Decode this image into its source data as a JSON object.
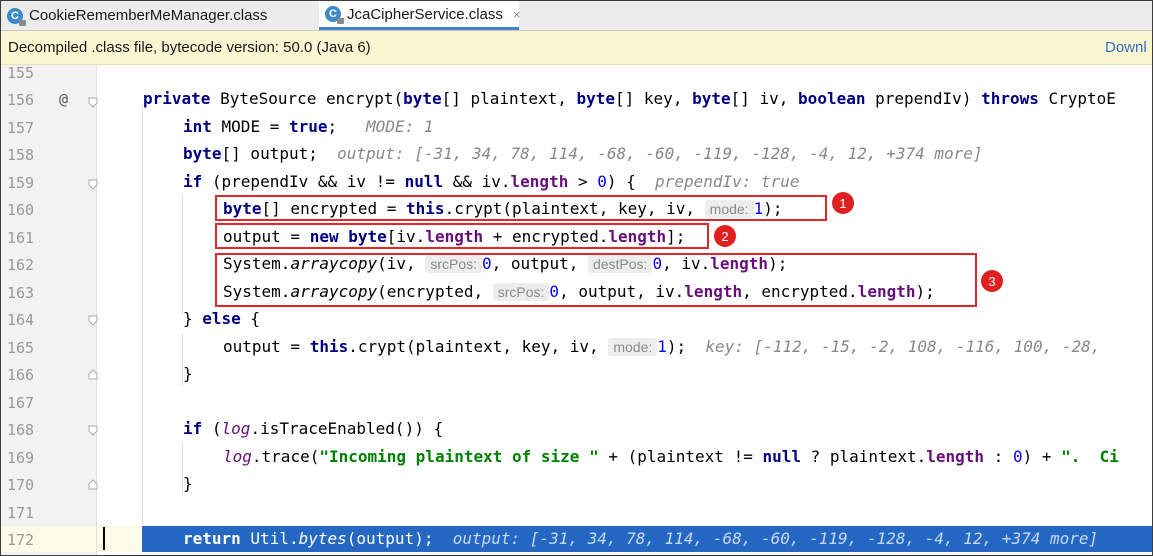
{
  "tabs": [
    {
      "label": "CookieRememberMeManager.class",
      "icon": "class-icon"
    },
    {
      "label": "JcaCipherService.class",
      "icon": "class-icon",
      "active": true,
      "close": "×"
    }
  ],
  "notice": {
    "message": "Decompiled .class file, bytecode version: 50.0 (Java 6)",
    "action": "Downl"
  },
  "annotation_marker": "@",
  "lines": [
    "155",
    "156",
    "157",
    "158",
    "159",
    "160",
    "161",
    "162",
    "163",
    "164",
    "165",
    "166",
    "167",
    "168",
    "169",
    "170",
    "171",
    "172"
  ],
  "code": {
    "l156": {
      "kw1": "private",
      "t1": " ByteSource encrypt(",
      "kw2": "byte",
      "t2": "[] plaintext, ",
      "kw3": "byte",
      "t3": "[] key, ",
      "kw4": "byte",
      "t4": "[] iv, ",
      "kw5": "boolean",
      "t5": " prependIv) ",
      "kw6": "throws",
      "t6": " CryptoE"
    },
    "l157": {
      "kw1": "int",
      "t1": " MODE = ",
      "kw2": "true",
      "t2": ";",
      "hint": "MODE: 1"
    },
    "l158": {
      "kw1": "byte",
      "t1": "[] output;",
      "hint": "output: [-31, 34, 78, 114, -68, -60, -119, -128, -4, 12, +374 more]"
    },
    "l159": {
      "kw1": "if",
      "t1": " (prependIv && iv != ",
      "kw2": "null",
      "t2": " && iv.",
      "f1": "length",
      "t3": " > ",
      "n1": "0",
      "t4": ") {",
      "hint": "prependIv: true"
    },
    "l160": {
      "kw1": "byte",
      "t1": "[] encrypted = ",
      "kw2": "this",
      "t2": ".crypt(plaintext, key, iv, ",
      "p1": "mode:",
      "n1": "1",
      "t3": ");"
    },
    "l161": {
      "t1": "output = ",
      "kw1": "new",
      "t2": " ",
      "kw2": "byte",
      "t3": "[iv.",
      "f1": "length",
      "t4": " + encrypted.",
      "f2": "length",
      "t5": "];"
    },
    "l162": {
      "t1": "System.",
      "m1": "arraycopy",
      "t2": "(iv, ",
      "p1": "srcPos:",
      "n1": "0",
      "t3": ", output, ",
      "p2": "destPos:",
      "n2": "0",
      "t4": ", iv.",
      "f1": "length",
      "t5": ");"
    },
    "l163": {
      "t1": "System.",
      "m1": "arraycopy",
      "t2": "(encrypted, ",
      "p1": "srcPos:",
      "n1": "0",
      "t3": ", output, iv.",
      "f1": "length",
      "t4": ", encrypted.",
      "f2": "length",
      "t5": ");"
    },
    "l164": {
      "t1": "} ",
      "kw1": "else",
      "t2": " {"
    },
    "l165": {
      "t1": "output = ",
      "kw1": "this",
      "t2": ".crypt(plaintext, key, iv, ",
      "p1": "mode:",
      "n1": "1",
      "t3": ");",
      "hint": "key: [-112, -15, -2, 108, -116, 100, -28,"
    },
    "l166": {
      "t1": "}"
    },
    "l168": {
      "kw1": "if",
      "t1": " (",
      "f1": "log",
      "t2": ".isTraceEnabled()) {"
    },
    "l169": {
      "f1": "log",
      "t1": ".trace(",
      "s1": "\"Incoming plaintext of size \"",
      "t2": " + (plaintext != ",
      "kw1": "null",
      "t3": " ? plaintext.",
      "f2": "length",
      "t4": " : ",
      "n1": "0",
      "t5": ") + ",
      "s2": "\".  Ci"
    },
    "l170": {
      "t1": "}"
    },
    "l172": {
      "kw1": "return",
      "t1": " Util.",
      "m1": "bytes",
      "t2": "(output);",
      "hint": "output: [-31, 34, 78, 114, -68, -60, -119, -128, -4, 12, +374 more]"
    }
  },
  "badges": [
    "1",
    "2",
    "3"
  ],
  "colors": {
    "highlight_box": "#e02828",
    "selection": "#2468c4",
    "keyword": "#000080",
    "number": "#0000ff",
    "string": "#008000",
    "field": "#660e7a"
  }
}
